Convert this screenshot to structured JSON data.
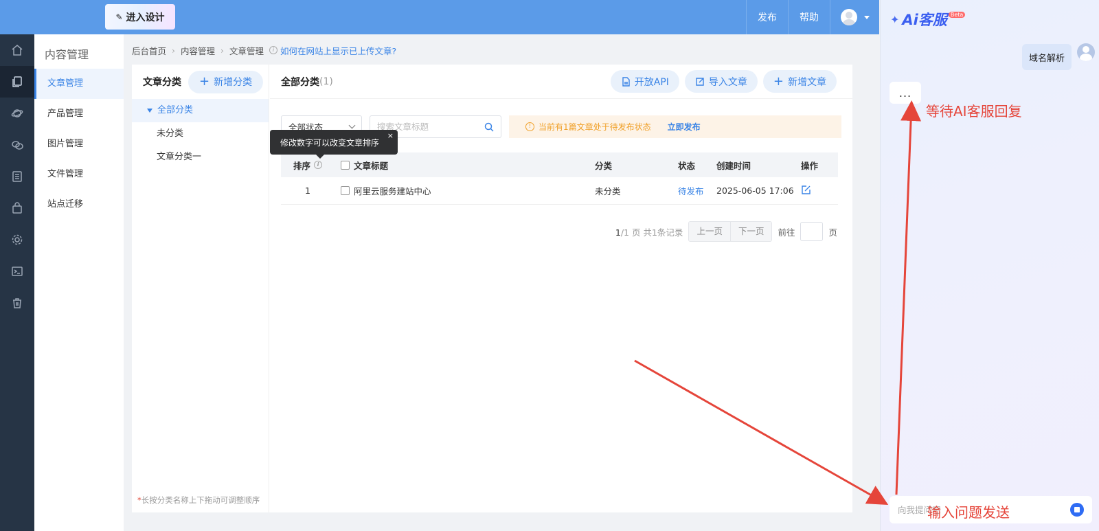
{
  "topbar": {
    "design_button": "进入设计",
    "publish": "发布",
    "help": "帮助"
  },
  "rail": {
    "icons": [
      "home-icon",
      "pages-icon",
      "planet-icon",
      "chat-icon",
      "list-icon",
      "bag-icon",
      "gear-icon",
      "terminal-icon",
      "trash-icon"
    ],
    "active_index": 1
  },
  "submenu": {
    "title": "内容管理",
    "items": [
      "文章管理",
      "产品管理",
      "图片管理",
      "文件管理",
      "站点迁移"
    ],
    "active_index": 0
  },
  "breadcrumb": {
    "items": [
      "后台首页",
      "内容管理",
      "文章管理"
    ],
    "help_link": "如何在网站上显示已上传文章?"
  },
  "categories": {
    "title": "文章分类",
    "add_button": "新增分类",
    "all": "全部分类",
    "items": [
      "未分类",
      "文章分类一"
    ],
    "tip_star": "*",
    "tip": "长按分类名称上下拖动可调整顺序"
  },
  "list": {
    "title": "全部分类",
    "count": "(1)",
    "buttons": [
      "开放API",
      "导入文章",
      "新增文章"
    ],
    "status_select": "全部状态",
    "search_placeholder": "搜索文章标题",
    "notice": "当前有1篇文章处于待发布状态",
    "notice_link": "立即发布",
    "columns": [
      "排序",
      "文章标题",
      "分类",
      "状态",
      "创建时间",
      "操作"
    ],
    "rows": [
      {
        "order": "1",
        "title": "阿里云服务建站中心",
        "category": "未分类",
        "status": "待发布",
        "created": "2025-06-05 17:06"
      }
    ],
    "tooltip": "修改数字可以改变文章排序",
    "tooltip_close": "×"
  },
  "pager": {
    "current": "1",
    "total": "/1",
    "page_label": "页",
    "records": "共1条记录",
    "prev": "上一页",
    "next": "下一页",
    "goto": "前往",
    "goto_suffix": "页"
  },
  "ai": {
    "logo": "Ai客服",
    "beta": "Beta",
    "user_message": "域名解析",
    "typing": "...",
    "input_placeholder": "向我提问吧"
  },
  "annotations": {
    "wait": "等待AI客服回复",
    "send": "输入问题发送",
    "color": "#e5453a"
  }
}
